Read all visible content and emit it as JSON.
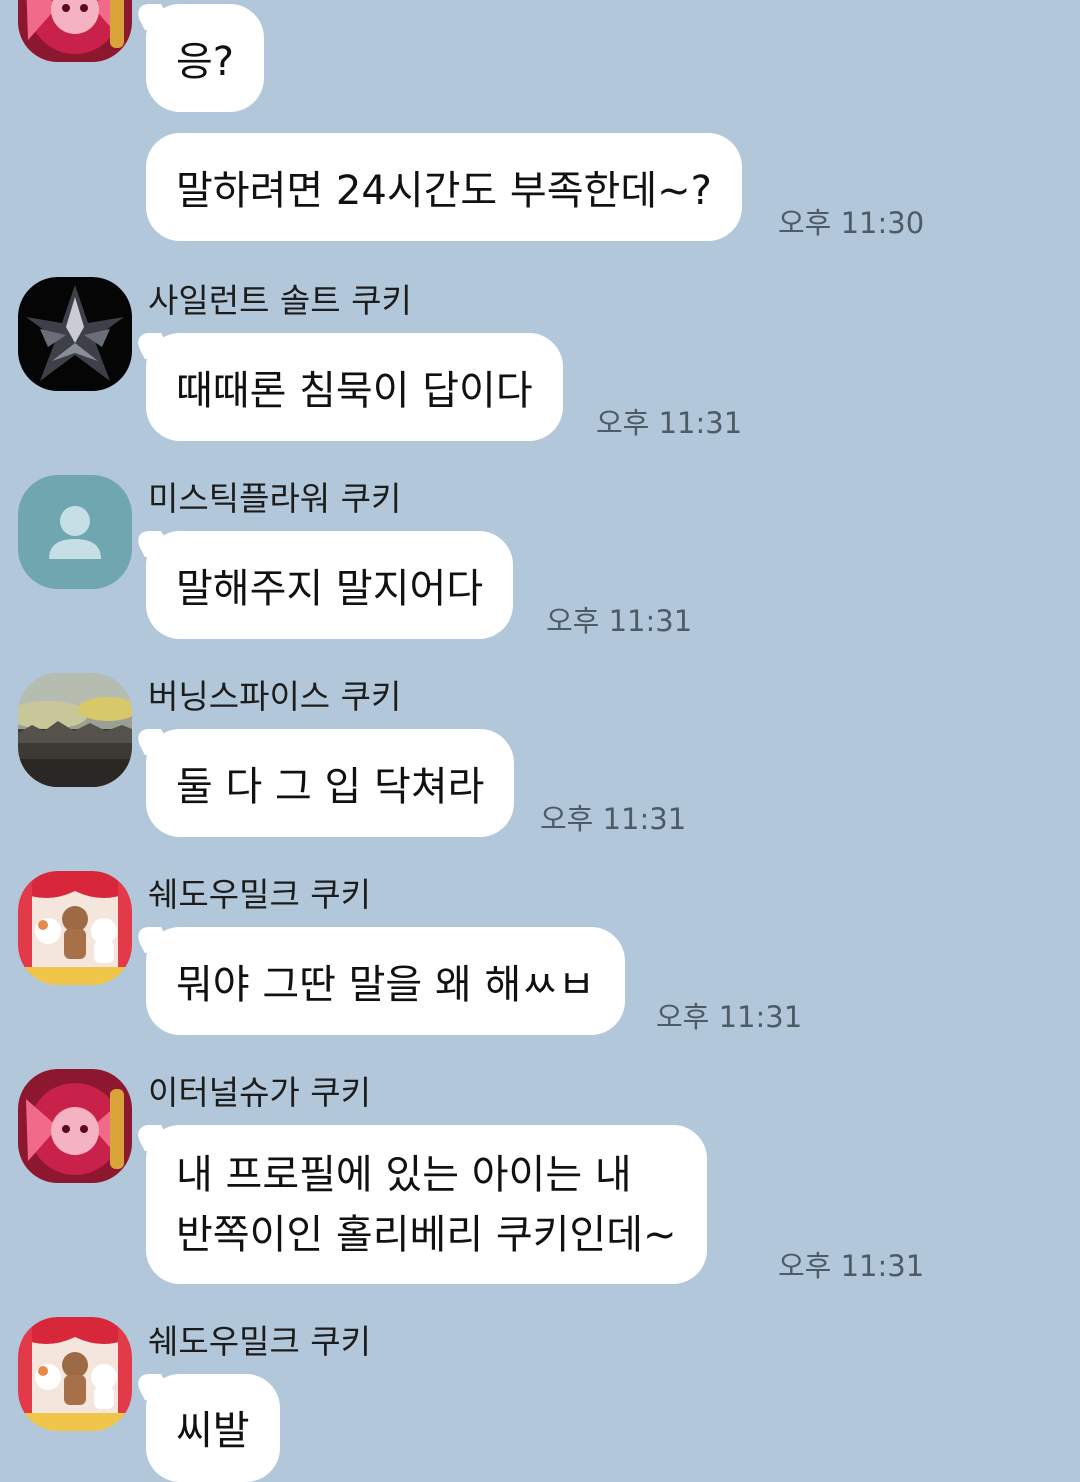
{
  "messages": [
    {
      "text": "응?"
    },
    {
      "text": "말하려면 24시간도 부족한데~?",
      "time": "오후 11:30"
    },
    {
      "sender": "사일런트 솔트 쿠키",
      "text": "때때론 침묵이 답이다",
      "time": "오후 11:31"
    },
    {
      "sender": "미스틱플라워 쿠키",
      "text": "말해주지 말지어다",
      "time": "오후 11:31"
    },
    {
      "sender": "버닝스파이스 쿠키",
      "text": "둘 다 그 입 닥쳐라",
      "time": "오후 11:31"
    },
    {
      "sender": "쉐도우밀크 쿠키",
      "text": "뭐야 그딴 말을 왜 해ㅆㅂ",
      "time": "오후 11:31"
    },
    {
      "sender": "이터널슈가 쿠키",
      "lines": [
        "내 프로필에 있는 아이는 내",
        "반쪽이인 홀리베리 쿠키인데~"
      ],
      "time": "오후 11:31"
    },
    {
      "sender": "쉐도우밀크 쿠키",
      "text": "씨발"
    }
  ],
  "avatars": [
    {
      "icon": "eternal-sugar-avatar-icon"
    },
    {
      "icon": "silent-salt-avatar-icon"
    },
    {
      "icon": "default-person-avatar-icon"
    },
    {
      "icon": "burning-landscape-avatar-icon"
    },
    {
      "icon": "puppet-theater-avatar-icon"
    },
    {
      "icon": "eternal-sugar-avatar-icon"
    },
    {
      "icon": "puppet-theater-avatar-icon"
    }
  ],
  "colors": {
    "background": "#b2c7d9",
    "bubble": "#ffffff",
    "time_text": "#4e5b66",
    "default_avatar": "#6fa6b0"
  }
}
